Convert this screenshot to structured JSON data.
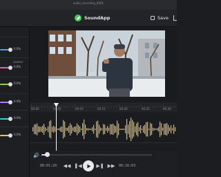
{
  "window": {
    "title": "audio_recording_0001"
  },
  "toolbar": {
    "brand_name": "SoundApp",
    "logo_icon": "leaf-logo-icon",
    "save_label": "Save",
    "share_icon": "share-icon"
  },
  "left_panel": {
    "controls": [
      {
        "value": "0.0%",
        "color": "#4aa3ff"
      },
      {
        "tag": "SAMPLE"
      },
      {
        "value": "0.0%",
        "color": "#ff5ea8"
      },
      {
        "value": "0.0%",
        "color": "#8fd14f"
      },
      {
        "value": "0.0%",
        "color": "#b77cff"
      },
      {
        "value": "0.0%",
        "color": "#41d1d6"
      },
      {
        "value": "0.0%",
        "color": "#f2c14e"
      }
    ]
  },
  "timeline": {
    "tick_labels": [
      "00:00",
      "00:05",
      "00:10",
      "00:15",
      "00:20",
      "00:25",
      "00:30"
    ],
    "waveform_color": "#f0b429"
  },
  "player": {
    "current_time": "00:01:20",
    "total_time": "00:16:03",
    "progress_fraction": 0.05
  }
}
